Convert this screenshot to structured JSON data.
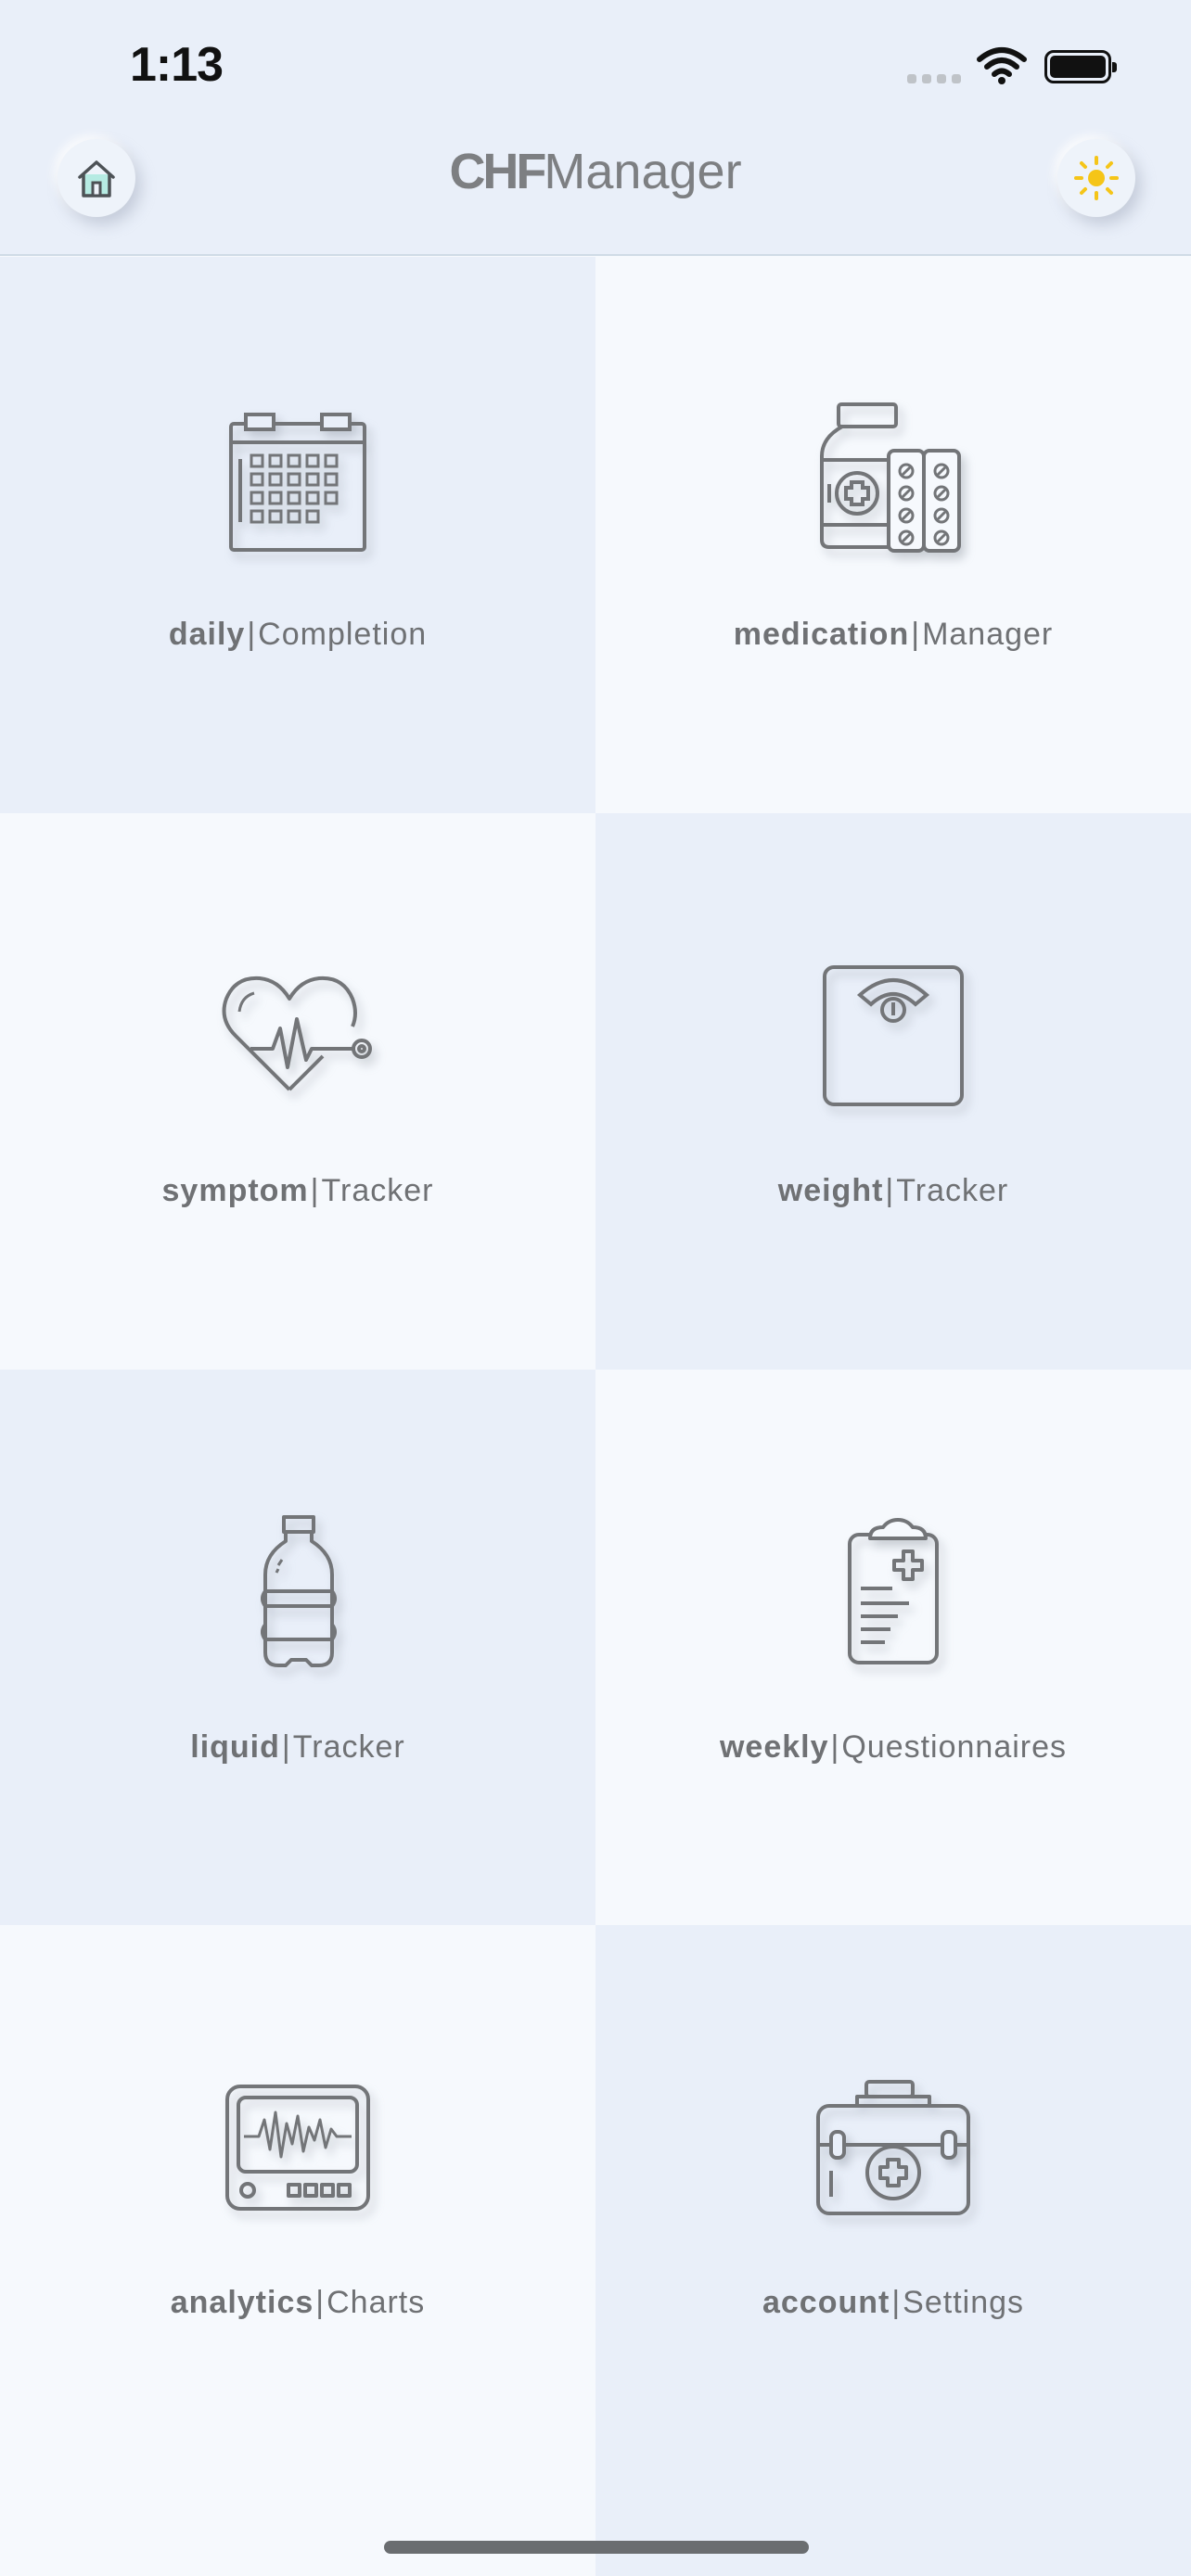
{
  "status_bar": {
    "time": "1:13"
  },
  "header": {
    "title_strong": "CHF",
    "title_light": "Manager",
    "home_icon": "home-icon",
    "theme_icon": "sun-icon",
    "accent_sun": "#f5c518",
    "accent_home": "#b6ebe3"
  },
  "tiles": [
    {
      "bold": "daily",
      "light": "Completion",
      "icon": "calendar-icon"
    },
    {
      "bold": "medication",
      "light": "Manager",
      "icon": "medicine-bottle-icon"
    },
    {
      "bold": "symptom",
      "light": "Tracker",
      "icon": "heart-stethoscope-icon"
    },
    {
      "bold": "weight",
      "light": "Tracker",
      "icon": "scale-icon"
    },
    {
      "bold": "liquid",
      "light": "Tracker",
      "icon": "water-bottle-icon"
    },
    {
      "bold": "weekly",
      "light": "Questionnaires",
      "icon": "clipboard-icon"
    },
    {
      "bold": "analytics",
      "light": "Charts",
      "icon": "monitor-icon"
    },
    {
      "bold": "account",
      "light": "Settings",
      "icon": "medical-kit-icon"
    }
  ],
  "separator": "|"
}
